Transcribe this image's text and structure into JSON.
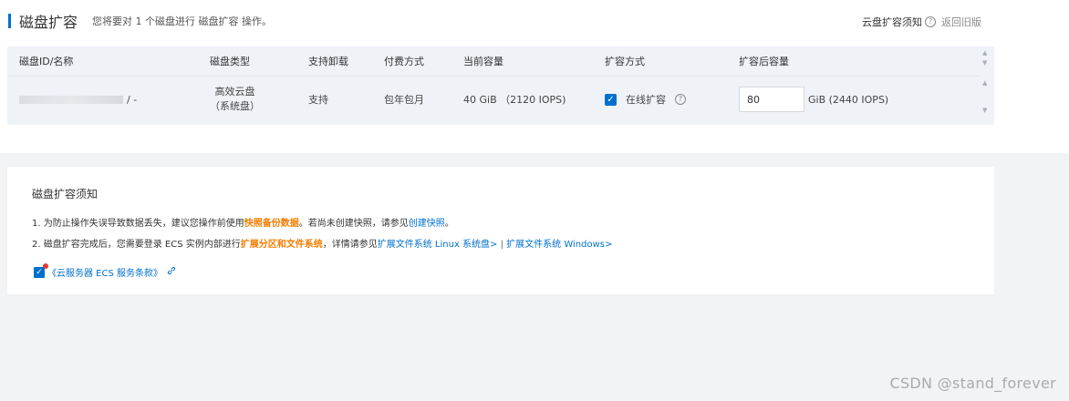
{
  "header": {
    "title": "磁盘扩容",
    "description": "您将要对 1 个磁盘进行 磁盘扩容 操作。",
    "notice_link": "云盘扩容须知",
    "help_icon": "?",
    "old_version_link": "返回旧版"
  },
  "table": {
    "columns": [
      "磁盘ID/名称",
      "磁盘类型",
      "支持卸载",
      "付费方式",
      "当前容量",
      "扩容方式",
      "扩容后容量"
    ],
    "row": {
      "id_suffix": "/ -",
      "type_line1": "高效云盘",
      "type_line2": "（系统盘）",
      "detachable": "支持",
      "payment": "包年包月",
      "current_capacity": "40 GiB （2120 IOPS)",
      "online_checked": true,
      "method_label": "在线扩容",
      "new_capacity_value": "80",
      "new_capacity_unit": "GiB (2440 IOPS)"
    }
  },
  "notice": {
    "title": "磁盘扩容须知",
    "line1": {
      "prefix": "1. 为防止操作失误导致数据丢失，建议您操作前使用",
      "highlight": "快照备份数据",
      "middle": "。若尚未创建快照，请参见",
      "link": "创建快照",
      "end": "。"
    },
    "line2": {
      "prefix": "2. 磁盘扩容完成后，您需要登录 ECS 实例内部进行",
      "highlight": "扩展分区和文件系统",
      "middle": "，详情请参见",
      "link_linux": "扩展文件系统 Linux 系统盘>",
      "separator": " | ",
      "link_windows": "扩展文件系统 Windows>"
    },
    "agreement": "《云服务器 ECS 服务条款》",
    "agreement_checked": true
  },
  "icons": {
    "check": "✓",
    "chain": "🔗",
    "scroll_up": "▲",
    "scroll_down": "▼"
  },
  "colors": {
    "accent": "#0070cc",
    "highlight": "#f57c00",
    "table_bg": "#eff3f8",
    "page_bg": "#f2f3f5"
  },
  "watermark": "CSDN @stand_forever"
}
